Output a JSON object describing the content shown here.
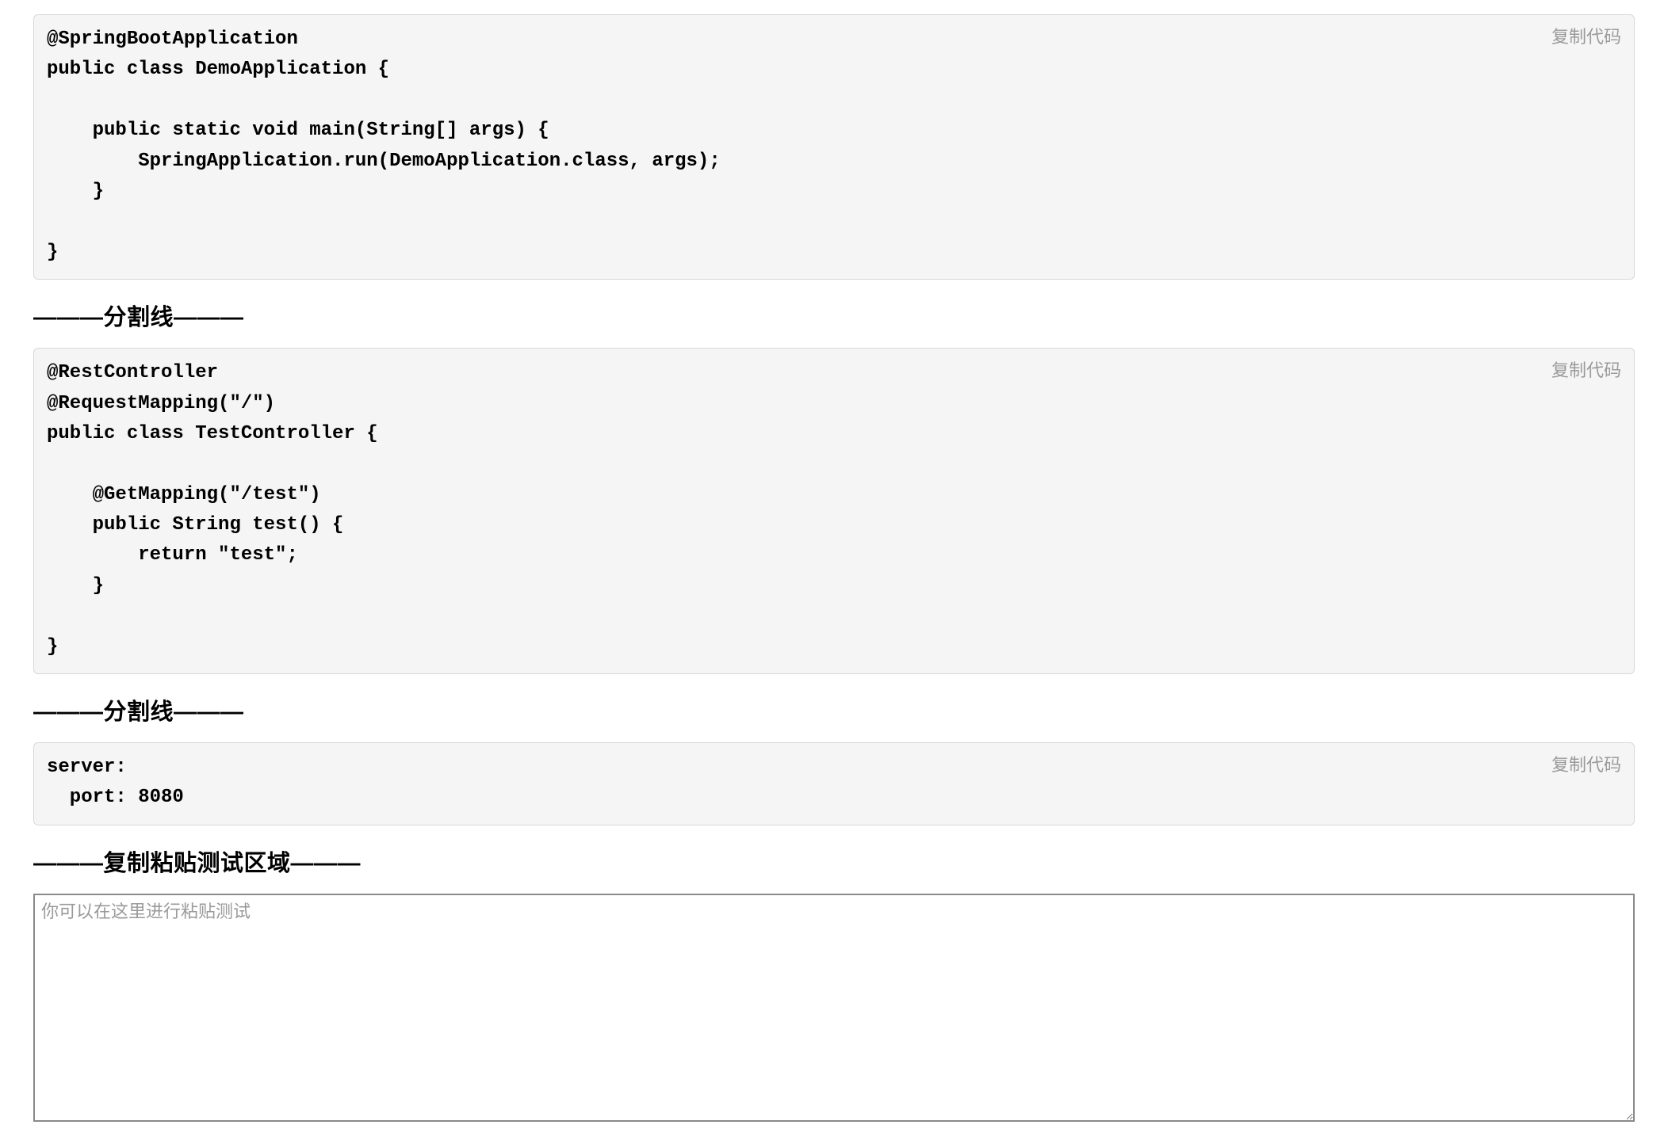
{
  "copy_label": "复制代码",
  "divider_label": "———分割线———",
  "test_area_label": "———复制粘贴测试区域———",
  "textarea_placeholder": "你可以在这里进行粘贴测试",
  "code_blocks": {
    "block1": "@SpringBootApplication\npublic class DemoApplication {\n\n    public static void main(String[] args) {\n        SpringApplication.run(DemoApplication.class, args);\n    }\n\n}",
    "block2": "@RestController\n@RequestMapping(\"/\")\npublic class TestController {\n\n    @GetMapping(\"/test\")\n    public String test() {\n        return \"test\";\n    }\n\n}",
    "block3": "server:\n  port: 8080"
  }
}
